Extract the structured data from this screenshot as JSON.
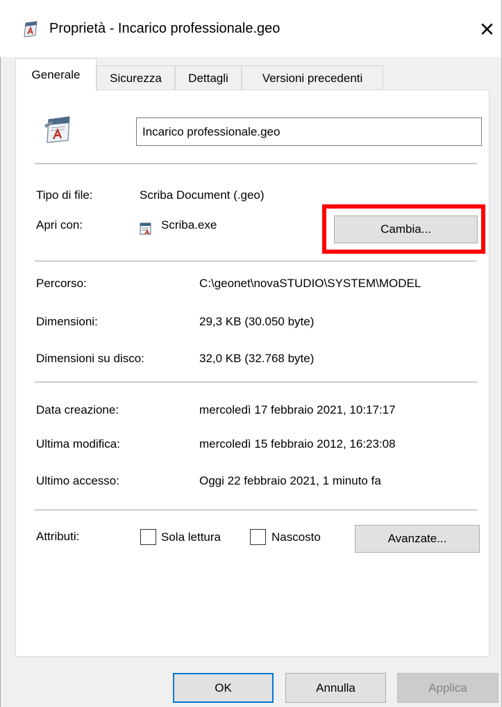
{
  "window": {
    "title": "Proprietà - Incarico professionale.geo",
    "close_glyph": "✕"
  },
  "tabs": [
    {
      "label": "Generale",
      "active": true
    },
    {
      "label": "Sicurezza",
      "active": false
    },
    {
      "label": "Dettagli",
      "active": false
    },
    {
      "label": "Versioni precedenti",
      "active": false
    }
  ],
  "general": {
    "file_name": "Incarico professionale.geo",
    "type_label": "Tipo di file:",
    "type_value": "Scriba Document (.geo)",
    "open_with_label": "Apri con:",
    "open_with_value": "Scriba.exe",
    "change_button": "Cambia...",
    "path_label": "Percorso:",
    "path_value": "C:\\geonet\\novaSTUDIO\\SYSTEM\\MODEL",
    "size_label": "Dimensioni:",
    "size_value": "29,3 KB (30.050 byte)",
    "size_disk_label": "Dimensioni su disco:",
    "size_disk_value": "32,0 KB (32.768 byte)",
    "created_label": "Data creazione:",
    "created_value": "mercoledì 17 febbraio 2021, 10:17:17",
    "modified_label": "Ultima modifica:",
    "modified_value": "mercoledì 15 febbraio 2012, 16:23:08",
    "accessed_label": "Ultimo accesso:",
    "accessed_value": "Oggi 22 febbraio 2021, 1 minuto fa",
    "attributes_label": "Attributi:",
    "readonly_label": "Sola lettura",
    "readonly_checked": false,
    "hidden_label": "Nascosto",
    "hidden_checked": false,
    "advanced_button": "Avanzate..."
  },
  "footer": {
    "ok": "OK",
    "cancel": "Annulla",
    "apply": "Applica"
  },
  "colors": {
    "highlight": "#ff0000",
    "primary_border": "#0078d7"
  }
}
